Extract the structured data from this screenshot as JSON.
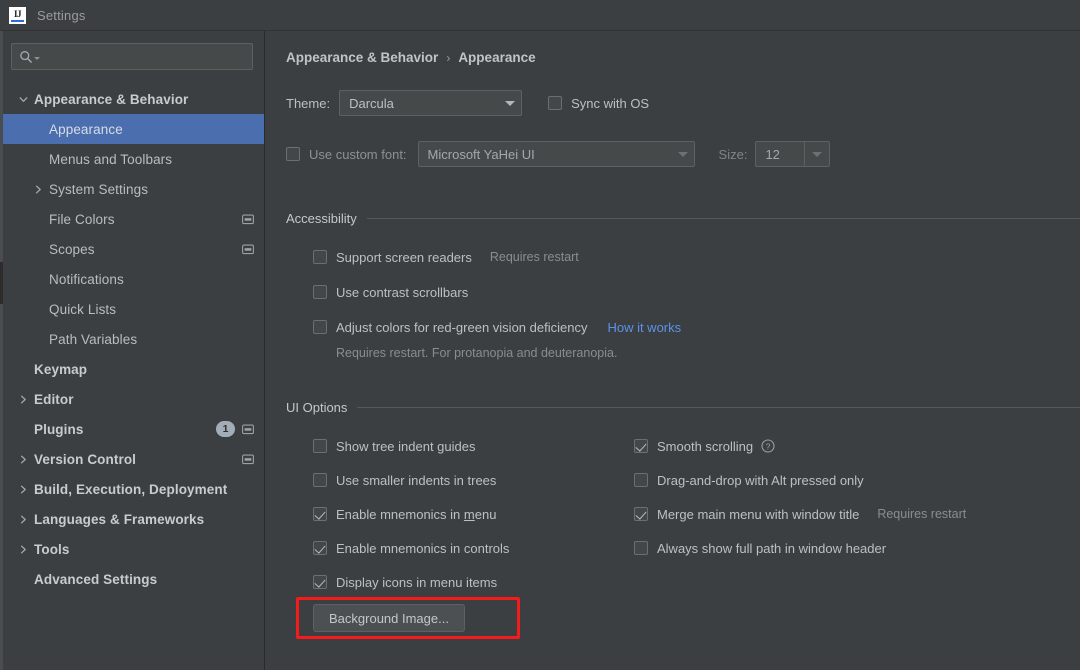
{
  "window": {
    "title": "Settings",
    "logo_text": "IJ",
    "logo_icon": "intellij-idea-logo"
  },
  "sidebar": {
    "search": {
      "value": "",
      "placeholder": "",
      "icon": "search-icon"
    },
    "items": [
      {
        "label": "Appearance & Behavior",
        "level": 0,
        "arrow": "down",
        "bold": true,
        "selected": false
      },
      {
        "label": "Appearance",
        "level": 1,
        "arrow": "none",
        "bold": false,
        "selected": true
      },
      {
        "label": "Menus and Toolbars",
        "level": 1,
        "arrow": "none",
        "bold": false,
        "selected": false
      },
      {
        "label": "System Settings",
        "level": 1,
        "arrow": "right",
        "bold": false,
        "selected": false
      },
      {
        "label": "File Colors",
        "level": 1,
        "arrow": "none",
        "bold": false,
        "selected": false,
        "config_icon": true
      },
      {
        "label": "Scopes",
        "level": 1,
        "arrow": "none",
        "bold": false,
        "selected": false,
        "config_icon": true
      },
      {
        "label": "Notifications",
        "level": 1,
        "arrow": "none",
        "bold": false,
        "selected": false
      },
      {
        "label": "Quick Lists",
        "level": 1,
        "arrow": "none",
        "bold": false,
        "selected": false
      },
      {
        "label": "Path Variables",
        "level": 1,
        "arrow": "none",
        "bold": false,
        "selected": false
      },
      {
        "label": "Keymap",
        "level": 0,
        "arrow": "none",
        "bold": true,
        "selected": false
      },
      {
        "label": "Editor",
        "level": 0,
        "arrow": "right",
        "bold": true,
        "selected": false
      },
      {
        "label": "Plugins",
        "level": 0,
        "arrow": "none",
        "bold": true,
        "selected": false,
        "badge": "1",
        "config_icon": true
      },
      {
        "label": "Version Control",
        "level": 0,
        "arrow": "right",
        "bold": true,
        "selected": false,
        "config_icon": true
      },
      {
        "label": "Build, Execution, Deployment",
        "level": 0,
        "arrow": "right",
        "bold": true,
        "selected": false
      },
      {
        "label": "Languages & Frameworks",
        "level": 0,
        "arrow": "right",
        "bold": true,
        "selected": false
      },
      {
        "label": "Tools",
        "level": 0,
        "arrow": "right",
        "bold": true,
        "selected": false
      },
      {
        "label": "Advanced Settings",
        "level": 0,
        "arrow": "none",
        "bold": true,
        "selected": false
      }
    ]
  },
  "content": {
    "breadcrumb": {
      "parent": "Appearance & Behavior",
      "separator": "›",
      "current": "Appearance"
    },
    "theme": {
      "label": "Theme:",
      "value": "Darcula",
      "sync_label": "Sync with OS",
      "sync_checked": false
    },
    "custom_font": {
      "checkbox_label": "Use custom font:",
      "checked": false,
      "value": "Microsoft YaHei UI",
      "size_label": "Size:",
      "size_value": "12"
    },
    "accessibility": {
      "title": "Accessibility",
      "options": [
        {
          "label": "Support screen readers",
          "checked": false,
          "note": "Requires restart"
        },
        {
          "label": "Use contrast scrollbars",
          "checked": false,
          "note": ""
        },
        {
          "label": "Adjust colors for red-green vision deficiency",
          "checked": false,
          "link": "How it works"
        }
      ],
      "sub_note": "Requires restart. For protanopia and deuteranopia."
    },
    "ui_options": {
      "title": "UI Options",
      "left": [
        {
          "label": "Show tree indent guides",
          "checked": false
        },
        {
          "label": "Use smaller indents in trees",
          "checked": false
        },
        {
          "label": "Enable mnemonics in menu",
          "checked": true,
          "mnemonic": "m"
        },
        {
          "label": "Enable mnemonics in controls",
          "checked": true
        },
        {
          "label": "Display icons in menu items",
          "checked": true
        }
      ],
      "right": [
        {
          "label": "Smooth scrolling",
          "checked": true,
          "help_icon": "help-icon"
        },
        {
          "label": "Drag-and-drop with Alt pressed only",
          "checked": false
        },
        {
          "label": "Merge main menu with window title",
          "checked": true,
          "note": "Requires restart"
        },
        {
          "label": "Always show full path in window header",
          "checked": false
        }
      ],
      "background_image_button": "Background Image..."
    }
  },
  "annotation": {
    "color": "#f51b1b",
    "target": "background-image-button"
  }
}
